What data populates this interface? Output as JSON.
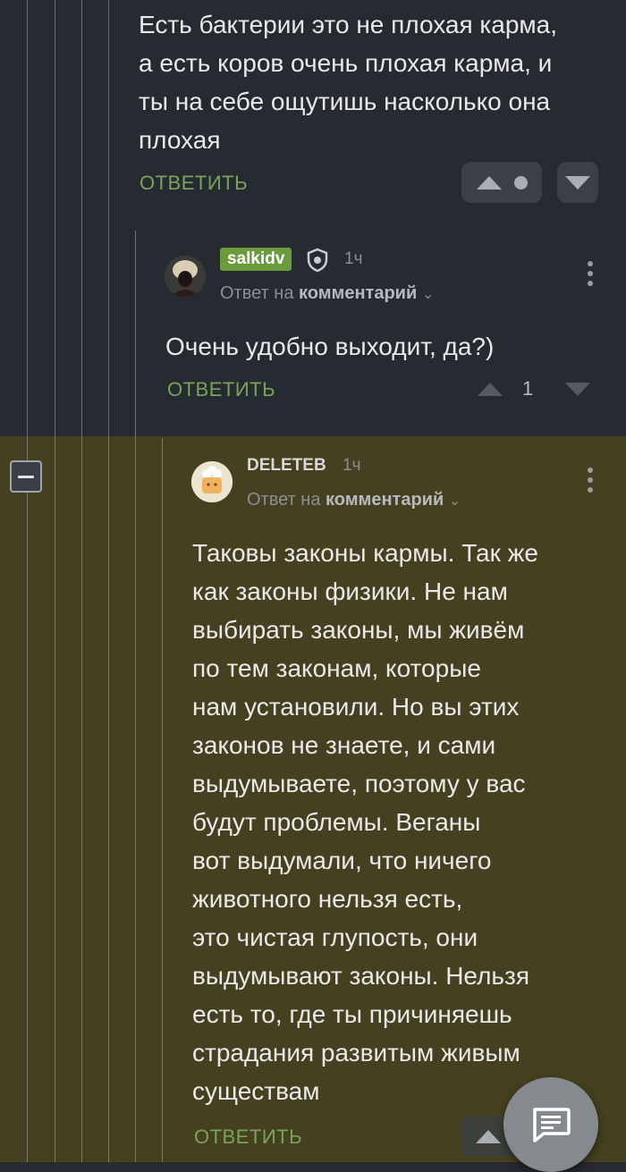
{
  "comments": {
    "first": {
      "text": "Есть бактерии это не плохая карма,\nа есть коров очень плохая карма, и\nты на себе ощутишь насколько она\nплохая",
      "reply_label": "ОТВЕТИТЬ"
    },
    "second": {
      "username": "salkidv",
      "time": "1ч",
      "reply_to_prefix": "Ответ на",
      "reply_to_target": "комментарий",
      "text": "Очень удобно выходит, да?)",
      "reply_label": "ОТВЕТИТЬ",
      "score": "1"
    },
    "third": {
      "username": "DELETEB",
      "time": "1ч",
      "reply_to_prefix": "Ответ на",
      "reply_to_target": "комментарий",
      "text": "Таковы законы кармы. Так же\nкак законы физики. Не нам\nвыбирать законы, мы живём\nпо тем законам, которые\nнам установили. Но вы этих\nзаконов не знаете, и сами\nвыдумываете, поэтому у вас\nбудут проблемы. Веганы\nвот выдумали, что ничего\nживотного нельзя есть,\nэто чистая глупость, они\nвыдумывают законы. Нельзя\nесть то, где ты причиняешь\nстрадания развитым живым\nсуществам",
      "reply_label": "ОТВЕТИТЬ"
    }
  },
  "colors": {
    "background_dark": "#262b31",
    "highlight_background": "#45401f",
    "reply_green": "#7aa35a",
    "username_badge": "#6a9c3e"
  },
  "icons": {
    "upvote": "triangle-up",
    "downvote": "triangle-down",
    "menu": "kebab-vertical",
    "verified": "shield",
    "fab": "chat-bubble"
  }
}
